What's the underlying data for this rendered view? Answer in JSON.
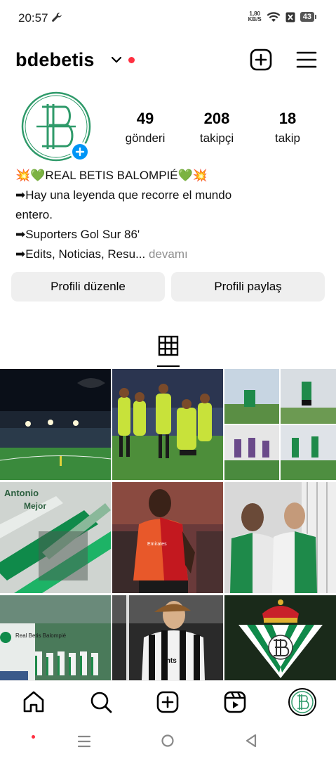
{
  "status_bar": {
    "time": "20:57",
    "net_speed_value": "1,80",
    "net_speed_unit": "KB/S",
    "battery": "43"
  },
  "header": {
    "username": "bdebetis"
  },
  "profile": {
    "stats": [
      {
        "value": "49",
        "label": "gönderi"
      },
      {
        "value": "208",
        "label": "takipçi"
      },
      {
        "value": "18",
        "label": "takip"
      }
    ],
    "bio": {
      "line1": "💥💚REAL BETIS BALOMPIÉ💚💥",
      "line2": "➡Hay una leyenda que recorre el mundo",
      "line3": "entero.",
      "line4": "➡Suporters Gol Sur 86'",
      "line5": "➡Edits, Noticias, Resu...",
      "more": "devamı"
    },
    "buttons": {
      "edit": "Profili düzenle",
      "share": "Profili paylaş"
    }
  },
  "posts": {
    "tile_text": {
      "antonio": "Antonio",
      "mejor": "Mejor",
      "sponsor": "Emirates",
      "real_betis": "Real Betis Balompié",
      "partizan": "mts"
    }
  },
  "colors": {
    "accent_blue": "#0095f6",
    "notification_red": "#ff2f40",
    "betis_green": "#00954c",
    "button_bg": "#efefef"
  }
}
